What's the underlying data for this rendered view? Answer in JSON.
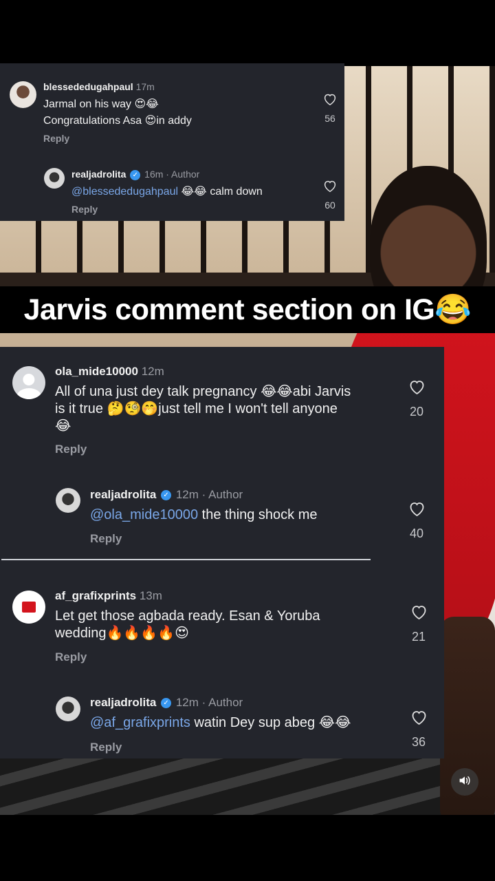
{
  "caption": "Jarvis comment section on IG😂",
  "top_panel": {
    "comment": {
      "username": "blessededugahpaul",
      "time": "17m",
      "line1": "Jarmal on his way 😍😂",
      "line2": "Congratulations Asa 😍in addy",
      "reply_label": "Reply",
      "likes": "56"
    },
    "reply": {
      "username": "realjadrolita",
      "time": "16m",
      "author_tag": "· Author",
      "mention": "@blessededugahpaul",
      "text": " 😂😂 calm down",
      "reply_label": "Reply",
      "likes": "60"
    }
  },
  "bottom_panel": {
    "comment1": {
      "username": "ola_mide10000",
      "time": "12m",
      "line1": "All of una just dey talk pregnancy 😂😂abi Jarvis",
      "line2": "is it true 🤔🧐🤭just tell me I won't tell anyone",
      "line3": "😂",
      "reply_label": "Reply",
      "likes": "20"
    },
    "reply1": {
      "username": "realjadrolita",
      "time": "12m",
      "author_tag": "· Author",
      "mention": "@ola_mide10000",
      "text": " the thing shock me",
      "reply_label": "Reply",
      "likes": "40"
    },
    "comment2": {
      "username": "af_grafixprints",
      "time": "13m",
      "line1": "Let get those agbada ready. Esan & Yoruba",
      "line2": "wedding🔥🔥🔥🔥😍",
      "reply_label": "Reply",
      "likes": "21"
    },
    "reply2": {
      "username": "realjadrolita",
      "time": "12m",
      "author_tag": "· Author",
      "mention": "@af_grafixprints",
      "text": " watin Dey sup abeg 😂😂",
      "reply_label": "Reply",
      "likes": "36"
    }
  },
  "icons": {
    "heart": "heart-outline-icon",
    "verified": "verified-badge-icon",
    "sound": "speaker-icon"
  },
  "colors": {
    "panel_bg": "#23252c",
    "mention": "#7aa7e8",
    "verified": "#3897f0"
  }
}
